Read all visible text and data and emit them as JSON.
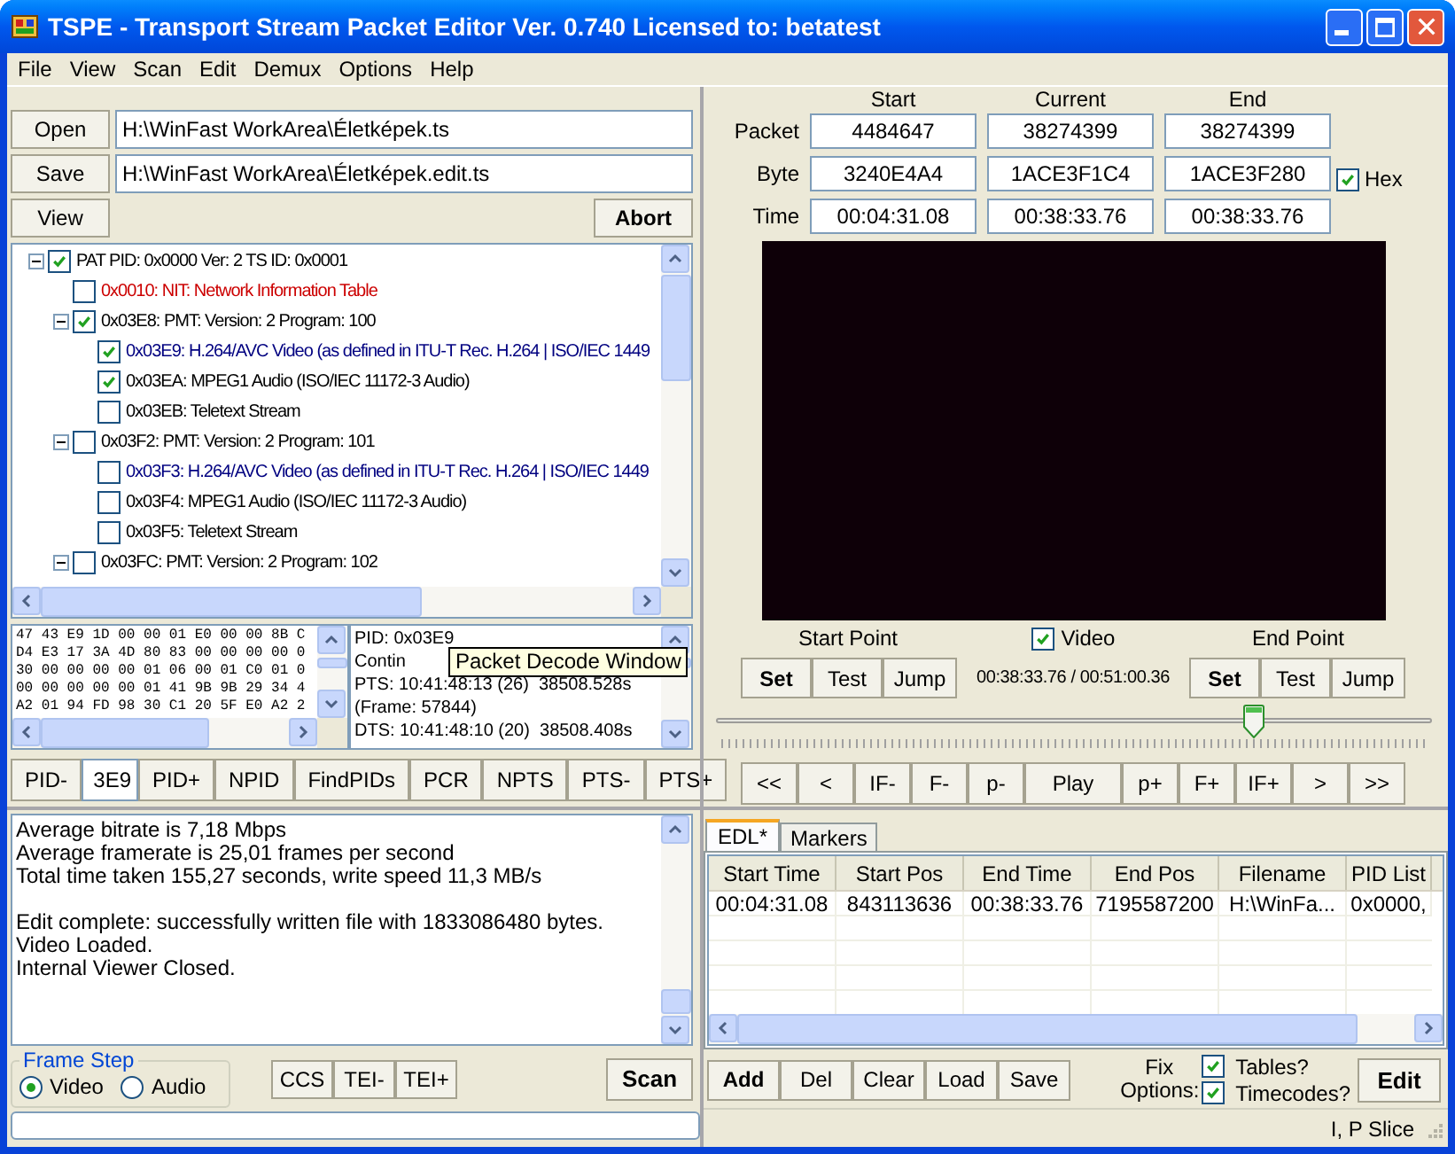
{
  "window": {
    "title": "TSPE - Transport Stream Packet Editor Ver. 0.740 Licensed to: betatest"
  },
  "menu": [
    {
      "label": "File"
    },
    {
      "label": "View"
    },
    {
      "label": "Scan"
    },
    {
      "label": "Edit"
    },
    {
      "label": "Demux"
    },
    {
      "label": "Options"
    },
    {
      "label": "Help"
    }
  ],
  "files": {
    "open_button": {
      "label": "Open"
    },
    "open_path": "H:\\WinFast WorkArea\\Életképek.ts",
    "save_button": {
      "label": "Save"
    },
    "save_path": "H:\\WinFast WorkArea\\Életképek.edit.ts",
    "view_button": {
      "label": "View"
    },
    "abort_button": {
      "label": "Abort",
      "bold": true
    }
  },
  "pid_tree": [
    {
      "label": "PAT PID: 0x0000 Ver: 2 TS ID: 0x0001",
      "checked": true,
      "expanded": true,
      "color": "#000000",
      "children": [
        {
          "label": "0x0010: NIT: Network Information Table",
          "checked": false,
          "color": "#cc0000"
        },
        {
          "label": "0x03E8: PMT: Version: 2 Program: 100",
          "checked": true,
          "expanded": true,
          "color": "#000000",
          "children": [
            {
              "label": "0x03E9: H.264/AVC Video (as defined in ITU-T Rec. H.264 | ISO/IEC 1449",
              "checked": true,
              "color": "#000080"
            },
            {
              "label": "0x03EA: MPEG1 Audio (ISO/IEC 11172-3 Audio)",
              "checked": true,
              "color": "#000000"
            },
            {
              "label": "0x03EB: Teletext Stream",
              "checked": false,
              "color": "#000000"
            }
          ]
        },
        {
          "label": "0x03F2: PMT: Version: 2 Program: 101",
          "checked": false,
          "expanded": true,
          "color": "#000000",
          "children": [
            {
              "label": "0x03F3: H.264/AVC Video (as defined in ITU-T Rec. H.264 | ISO/IEC 1449",
              "checked": false,
              "color": "#000080"
            },
            {
              "label": "0x03F4: MPEG1 Audio (ISO/IEC 11172-3 Audio)",
              "checked": false,
              "color": "#000000"
            },
            {
              "label": "0x03F5: Teletext Stream",
              "checked": false,
              "color": "#000000"
            }
          ]
        },
        {
          "label": "0x03FC: PMT: Version: 2 Program: 102",
          "checked": false,
          "expanded": true,
          "color": "#000000"
        }
      ]
    }
  ],
  "hex_dump": [
    "47 43 E9 1D 00 00 01 E0 00 00 8B C",
    "D4 E3 17 3A 4D 80 83 00 00 00 00 0",
    "30 00 00 00 00 01 06 00 01 C0 01 0",
    "00 00 00 00 00 01 41 9B 9B 29 34 4",
    "A2 01 94 FD 98 30 C1 20 5F E0 A2 2"
  ],
  "packet_decode": {
    "lines": [
      "PID: 0x03E9",
      "Contin",
      "PTS: 10:41:48:13 (26)  38508.528s",
      "(Frame: 57844)",
      "DTS: 10:41:48:10 (20)  38508.408s"
    ],
    "tooltip": "Packet Decode Window"
  },
  "pid_bar": [
    {
      "kind": "button",
      "label": "PID-"
    },
    {
      "kind": "field",
      "value": "3E9"
    },
    {
      "kind": "button",
      "label": "PID+"
    },
    {
      "kind": "button",
      "label": "NPID"
    },
    {
      "kind": "button",
      "label": "FindPIDs"
    },
    {
      "kind": "button",
      "label": "PCR"
    },
    {
      "kind": "button",
      "label": "NPTS"
    },
    {
      "kind": "button",
      "label": "PTS-"
    },
    {
      "kind": "button",
      "label": "PTS+"
    }
  ],
  "log": [
    [
      "Average bitrate is 7,18 Mbps",
      "Average framerate is 25,01 frames per second",
      "Total time taken 155,27 seconds, write speed 11,3 MB/s"
    ],
    [
      "Edit complete: successfully written file with 1833086480 bytes.",
      "Video Loaded.",
      "Internal Viewer Closed."
    ]
  ],
  "frame_step": {
    "title": "Frame Step",
    "options": [
      {
        "label": "Video",
        "selected": true
      },
      {
        "label": "Audio",
        "selected": false
      }
    ]
  },
  "flag_buttons": [
    "CCS",
    "TEI-",
    "TEI+"
  ],
  "scan_button": {
    "label": "Scan",
    "bold": true
  },
  "progress": {
    "level": 0
  },
  "positions": {
    "columns": [
      "Start",
      "Current",
      "End"
    ],
    "rows": [
      {
        "label": "Packet",
        "values": [
          "4484647",
          "38274399",
          "38274399"
        ]
      },
      {
        "label": "Byte",
        "values": [
          "3240E4A4",
          "1ACE3F1C4",
          "1ACE3F280"
        ]
      },
      {
        "label": "Time",
        "values": [
          "00:04:31.08",
          "00:38:33.76",
          "00:38:33.76"
        ]
      }
    ],
    "hex": {
      "label": "Hex",
      "checked": true
    }
  },
  "start_point": {
    "label": "Start Point",
    "buttons": [
      {
        "label": "Set",
        "bold": true
      },
      {
        "label": "Test",
        "bold": false
      },
      {
        "label": "Jump",
        "bold": false
      }
    ]
  },
  "video_toggle": {
    "label": "Video",
    "checked": true
  },
  "time_readout": "00:38:33.76 / 00:51:00.36",
  "end_point": {
    "label": "End Point",
    "buttons": [
      {
        "label": "Set",
        "bold": true
      },
      {
        "label": "Test",
        "bold": false
      },
      {
        "label": "Jump",
        "bold": false
      }
    ]
  },
  "seek_slider": {
    "level": 0.75
  },
  "nav_buttons": [
    {
      "kind": "step",
      "label": "<<"
    },
    {
      "kind": "step",
      "label": "<"
    },
    {
      "kind": "step",
      "label": "IF-"
    },
    {
      "kind": "step",
      "label": "F-"
    },
    {
      "kind": "step",
      "label": "p-"
    },
    {
      "kind": "play",
      "label": "Play"
    },
    {
      "kind": "step",
      "label": "p+"
    },
    {
      "kind": "step",
      "label": "F+"
    },
    {
      "kind": "step",
      "label": "IF+"
    },
    {
      "kind": "step",
      "label": ">"
    },
    {
      "kind": "step",
      "label": ">>"
    }
  ],
  "edl_tabs": [
    {
      "label": "EDL*",
      "selected": true
    },
    {
      "label": "Markers",
      "selected": false
    }
  ],
  "edl_table": {
    "columns": [
      "Start Time",
      "Start Pos",
      "End Time",
      "End Pos",
      "Filename",
      "PID List"
    ],
    "rows": [
      [
        "00:04:31.08",
        "843113636",
        "00:38:33.76",
        "7195587200",
        "H:\\WinFa...",
        "0x0000,"
      ]
    ]
  },
  "edl_buttons": [
    {
      "label": "Add",
      "bold": true
    },
    {
      "label": "Del",
      "bold": false
    },
    {
      "label": "Clear",
      "bold": false
    },
    {
      "label": "Load",
      "bold": false
    },
    {
      "label": "Save",
      "bold": false
    }
  ],
  "fix_options": {
    "label": "Fix Options:",
    "options": [
      {
        "label": "Tables?",
        "checked": true
      },
      {
        "label": "Timecodes?",
        "checked": true
      }
    ]
  },
  "edit_button": {
    "label": "Edit",
    "bold": true
  },
  "status_bar": "I, P Slice"
}
